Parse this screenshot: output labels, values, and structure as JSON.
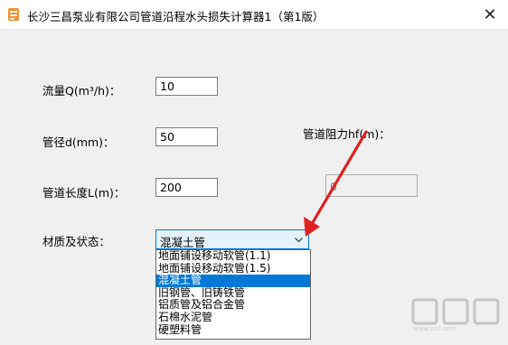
{
  "window": {
    "title": "长沙三昌泵业有限公司管道沿程水头损失计算器1（第1版）",
    "close_glyph": "✕"
  },
  "form": {
    "flow_label": "流量Q(m³/h)：",
    "flow_value": "10",
    "diameter_label": "管径d(mm)：",
    "diameter_value": "50",
    "length_label": "管道长度L(m)：",
    "length_value": "200",
    "material_label": "材质及状态：",
    "material_value": "混凝土管",
    "resistance_label": "管道阻力hf(m)：",
    "resistance_value": "0"
  },
  "dropdown": {
    "options": [
      "地面铺设移动软管(1.1)",
      "地面铺设移动软管(1.5)",
      "混凝土管",
      "旧钢管、旧铸铁管",
      "铝质管及铝合金管",
      "石棉水泥管",
      "硬塑料管"
    ],
    "selected_index": 2
  },
  "watermark": {
    "site": "www.xz7.com"
  },
  "colors": {
    "accent": "#0078d7",
    "arrow": "#e02020",
    "app_icon": "#f0902a"
  },
  "icons": {
    "app": "app-icon",
    "close": "close-icon",
    "dropdown": "chevron-down-icon",
    "annotation": "red-arrow"
  }
}
